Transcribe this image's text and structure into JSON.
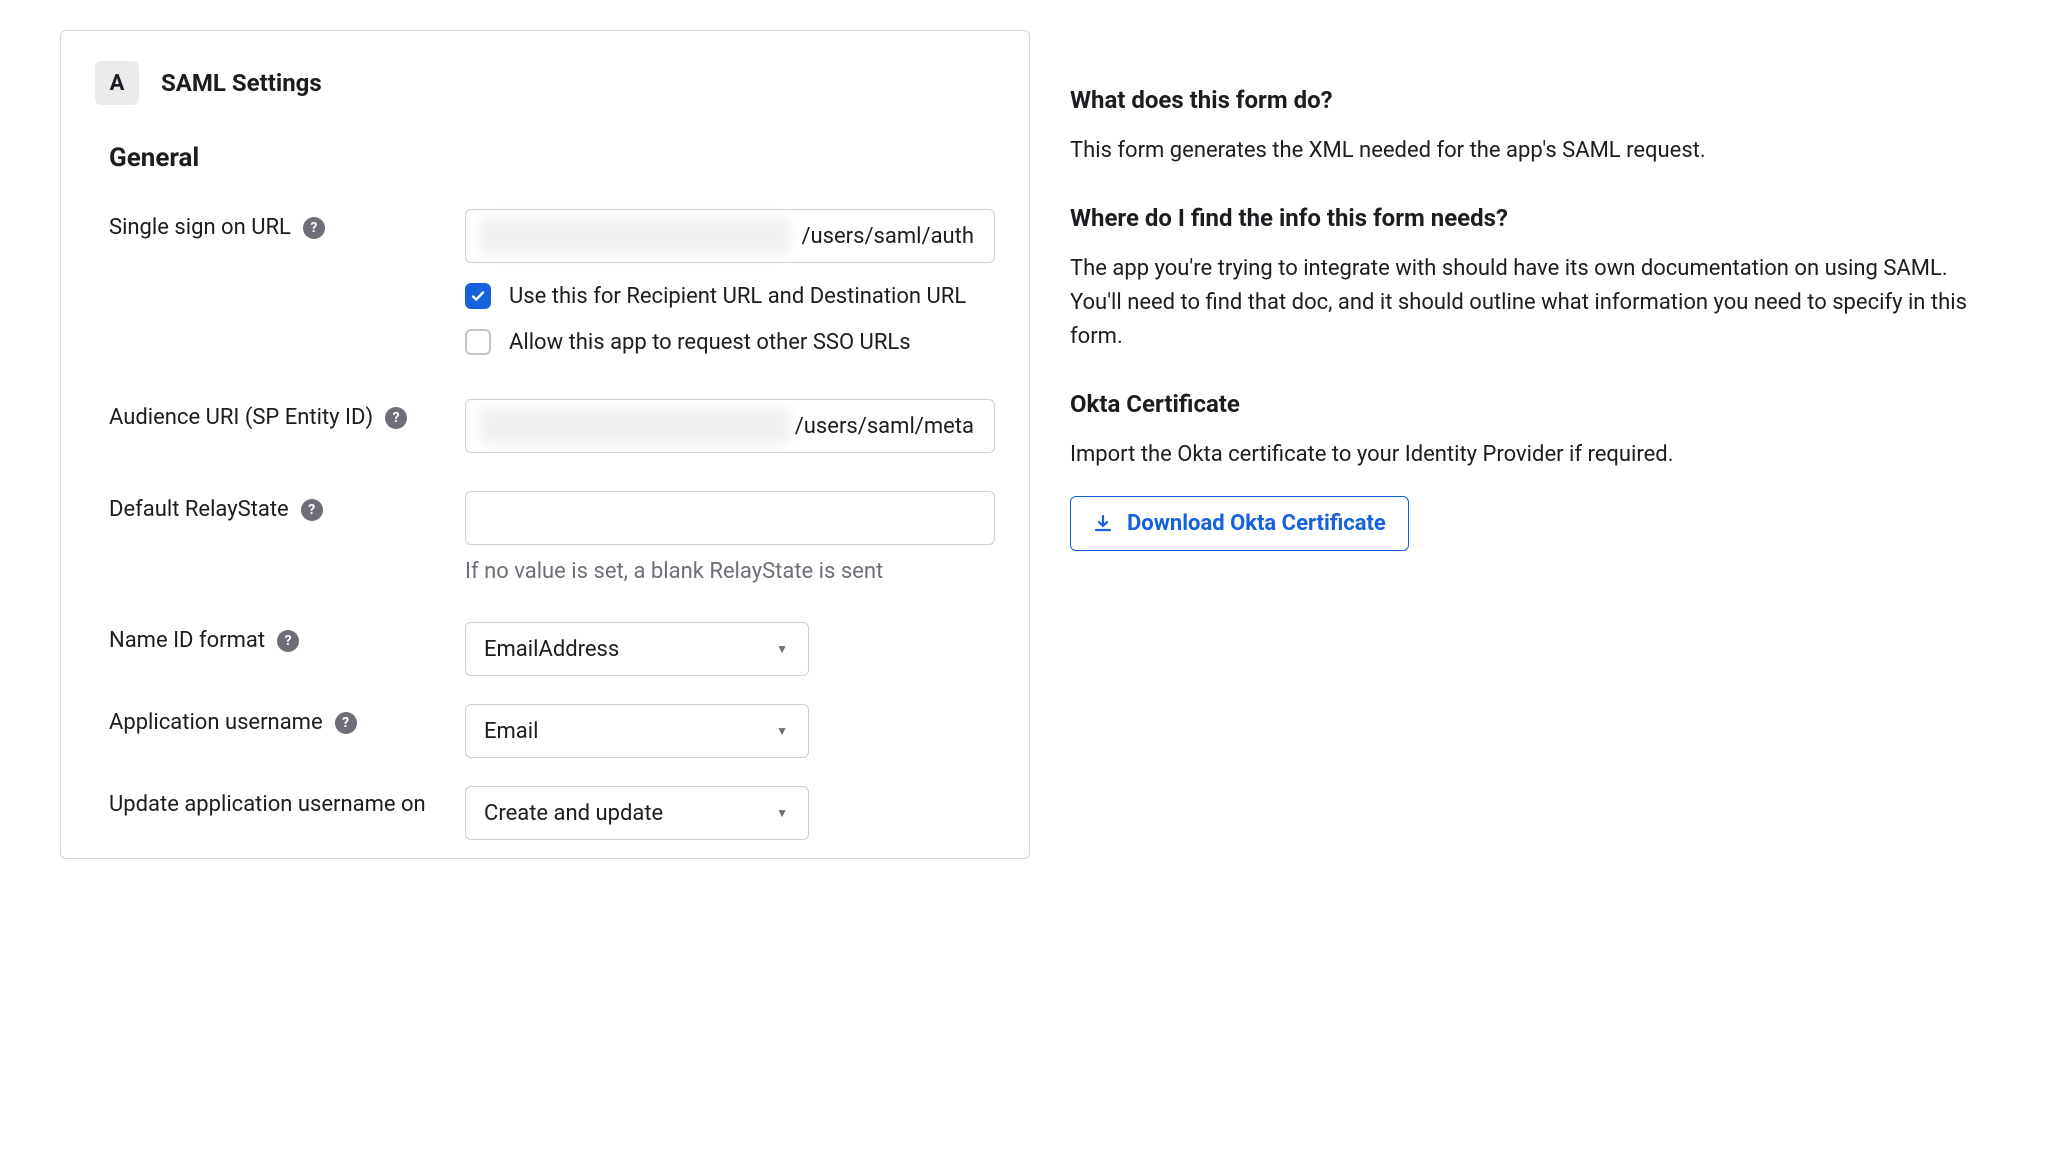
{
  "section": {
    "badge": "A",
    "title": "SAML Settings",
    "general": "General"
  },
  "fields": {
    "sso_url": {
      "label": "Single sign on URL",
      "value_tail": "/users/saml/auth",
      "cb_use_recipient": "Use this for Recipient URL and Destination URL",
      "cb_allow_other": "Allow this app to request other SSO URLs"
    },
    "audience_uri": {
      "label": "Audience URI (SP Entity ID)",
      "value_tail": "/users/saml/meta"
    },
    "relaystate": {
      "label": "Default RelayState",
      "value": "",
      "hint": "If no value is set, a blank RelayState is sent"
    },
    "nameid": {
      "label": "Name ID format",
      "value": "EmailAddress"
    },
    "app_username": {
      "label": "Application username",
      "value": "Email"
    },
    "update_on": {
      "label": "Update application username on",
      "value": "Create and update"
    }
  },
  "side": {
    "h1": "What does this form do?",
    "p1": "This form generates the XML needed for the app's SAML request.",
    "h2": "Where do I find the info this form needs?",
    "p2": "The app you're trying to integrate with should have its own documentation on using SAML. You'll need to find that doc, and it should outline what information you need to specify in this form.",
    "h3": "Okta Certificate",
    "p3": "Import the Okta certificate to your Identity Provider if required.",
    "download": "Download Okta Certificate"
  }
}
